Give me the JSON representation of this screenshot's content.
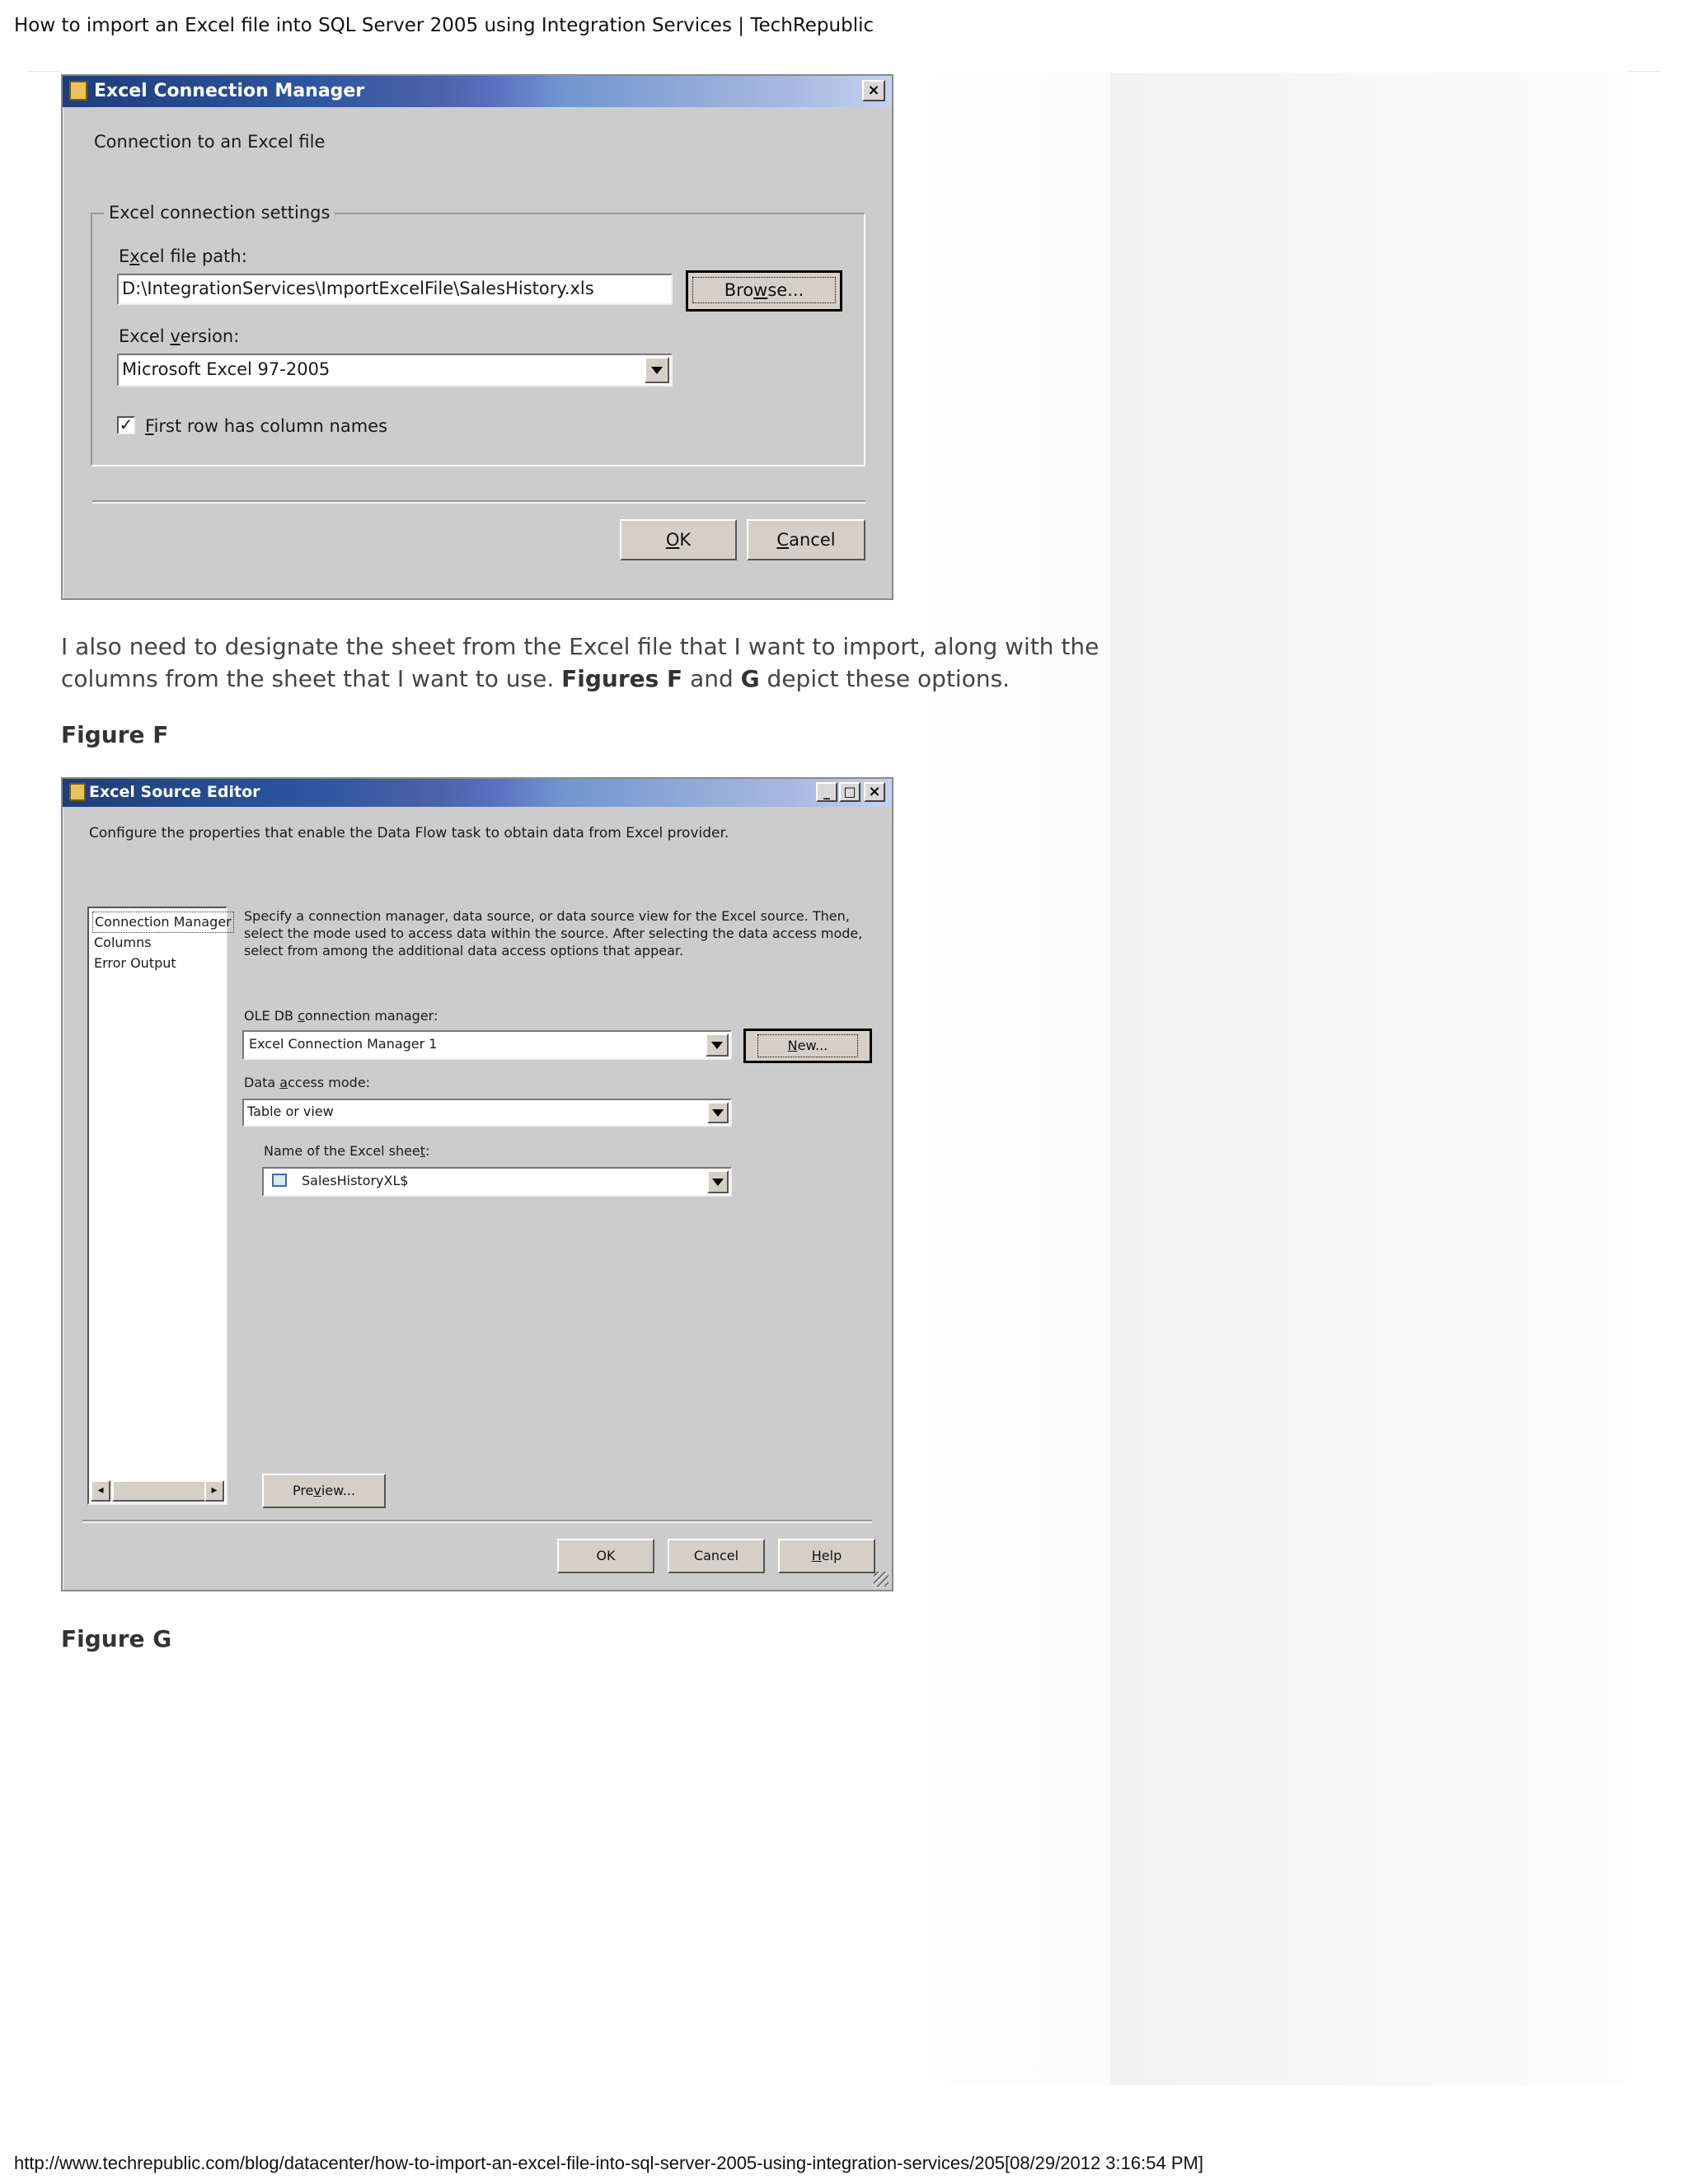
{
  "print_header": "How to import an Excel file into SQL Server 2005 using Integration Services | TechRepublic",
  "print_footer": "http://www.techrepublic.com/blog/datacenter/how-to-import-an-excel-file-into-sql-server-2005-using-integration-services/205[08/29/2012 3:16:54 PM]",
  "excel_connection_dialog": {
    "title": "Excel Connection Manager",
    "close_glyph": "×",
    "subtitle": "Connection to an Excel file",
    "group_label": "Excel connection settings",
    "file_path_label_pre": "E",
    "file_path_label_ul": "x",
    "file_path_label_post": "cel file path:",
    "file_path_value": "D:\\IntegrationServices\\ImportExcelFile\\SalesHistory.xls",
    "browse_pre": "Bro",
    "browse_ul": "w",
    "browse_post": "se...",
    "version_label_pre": "Excel ",
    "version_label_ul": "v",
    "version_label_post": "ersion:",
    "version_value": "Microsoft Excel 97-2005",
    "first_row_checked": true,
    "first_row_ul": "F",
    "first_row_post": "irst row has column names",
    "ok_ul": "O",
    "ok_post": "K",
    "cancel_ul": "C",
    "cancel_post": "ancel"
  },
  "paragraph": {
    "part1": "I also need to designate the sheet from the Excel file that I want to import, along with the columns from the sheet that I want to use. ",
    "bold1": "Figures F",
    "part2": " and ",
    "bold2": "G",
    "part3": " depict these options."
  },
  "figure_f_caption": "Figure F",
  "figure_g_caption": "Figure G",
  "excel_source_editor": {
    "title": "Excel Source Editor",
    "minimize_glyph": "_",
    "maximize_glyph": "□",
    "close_glyph": "×",
    "description": "Configure the properties that enable the Data Flow task to obtain data from Excel provider.",
    "nav_items": [
      "Connection Manager",
      "Columns",
      "Error Output"
    ],
    "instructions": "Specify a connection manager, data source, or data source view for the Excel source. Then, select the mode used to access data within the source. After selecting the data access mode, select from among the additional data access options that appear.",
    "conn_mgr_label_pre": "OLE DB ",
    "conn_mgr_label_ul": "c",
    "conn_mgr_label_post": "onnection manager:",
    "conn_mgr_value": "Excel Connection Manager 1",
    "new_ul": "N",
    "new_post": "ew...",
    "access_mode_label_pre": "Data ",
    "access_mode_label_ul": "a",
    "access_mode_label_post": "ccess mode:",
    "access_mode_value": "Table or view",
    "sheet_label_pre": "Name of the Excel shee",
    "sheet_label_ul": "t",
    "sheet_label_post": ":",
    "sheet_value": "SalesHistoryXL$",
    "preview_pre": "Pre",
    "preview_ul": "v",
    "preview_post": "iew...",
    "ok_label": "OK",
    "cancel_label": "Cancel",
    "help_ul": "H",
    "help_post": "elp",
    "scroll_left_glyph": "◂",
    "scroll_right_glyph": "▸"
  }
}
